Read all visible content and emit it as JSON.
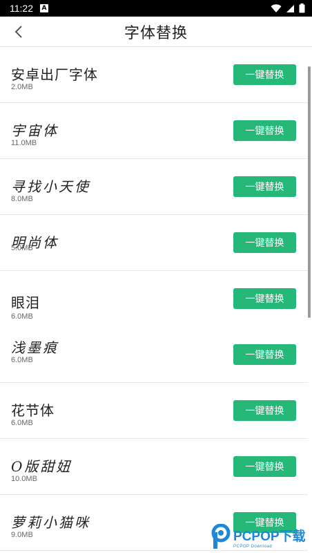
{
  "status_bar": {
    "time": "11:22",
    "notification_badge": "A"
  },
  "header": {
    "title": "字体替换"
  },
  "fonts": [
    {
      "name": "安卓出厂字体",
      "size": "2.0MB",
      "button": "一键替换"
    },
    {
      "name": "宇宙体",
      "size": "11.0MB",
      "button": "一键替换"
    },
    {
      "name": "寻找小天使",
      "size": "8.0MB",
      "button": "一键替换"
    },
    {
      "name": "明尚体",
      "size": "5.0MB",
      "button": "一键替换"
    },
    {
      "name": "眼泪",
      "size": "6.0MB",
      "button": "一键替换"
    },
    {
      "name": "浅墨痕",
      "size": "6.0MB",
      "button": "一键替换"
    },
    {
      "name": "花节体",
      "size": "6.0MB",
      "button": "一键替换"
    },
    {
      "name": "O版甜妞",
      "size": "10.0MB",
      "button": "一键替换"
    },
    {
      "name": "萝莉小猫咪",
      "size": "9.0MB",
      "button": "一键替换"
    }
  ],
  "watermark": {
    "brand": "PCPOP",
    "suffix": "下载",
    "subtitle": "PCPOP Download"
  },
  "colors": {
    "accent": "#26b878",
    "watermark": "#1e88d8"
  }
}
